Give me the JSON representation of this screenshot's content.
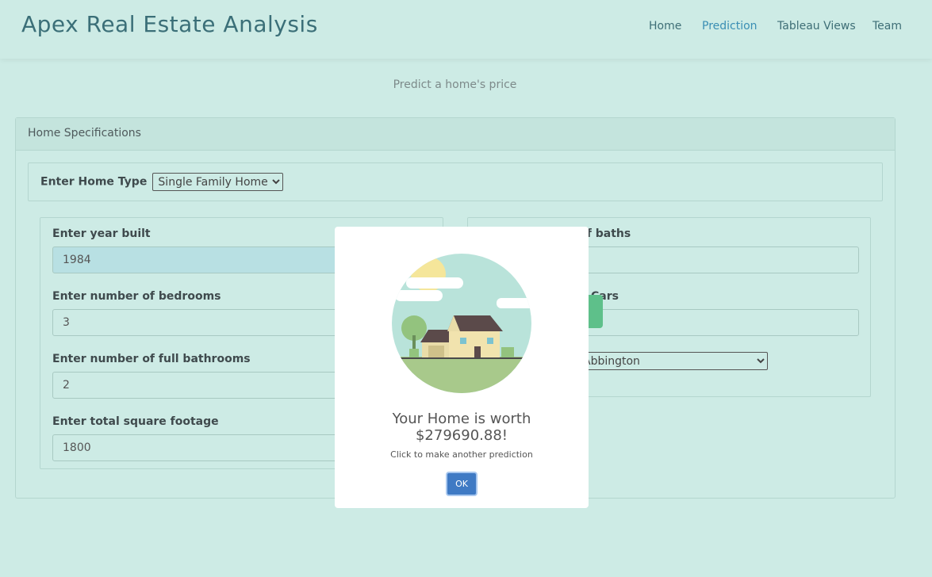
{
  "navbar": {
    "brand": "Apex Real Estate Analysis",
    "links": [
      "Home",
      "Prediction",
      "Tableau Views",
      "Team"
    ],
    "active": "Prediction"
  },
  "subtitle": "Predict a home's price",
  "card": {
    "header": "Home Specifications",
    "home_type_label": "Enter Home Type",
    "home_type_value": "Single Family Home"
  },
  "left_fields": [
    {
      "label": "Enter year built",
      "value": "1984"
    },
    {
      "label": "Enter number of bedrooms",
      "value": "3"
    },
    {
      "label": "Enter number of full bathrooms",
      "value": "2"
    },
    {
      "label": "Enter total square footage",
      "value": "1800"
    }
  ],
  "right_fields": {
    "half_baths_label_visible": "lf baths",
    "cars_label_visible": "Cars",
    "neighborhood_visible": "Abbington"
  },
  "modal": {
    "title_line1": "Your Home is worth",
    "title_line2": "$279690.88!",
    "text": "Click to make another prediction",
    "ok_label": "OK"
  },
  "colors": {
    "background": "#cdebe5",
    "accent": "#3a8eb4",
    "ok_button": "#3f7ac4",
    "submit_button": "#5ec08a"
  }
}
